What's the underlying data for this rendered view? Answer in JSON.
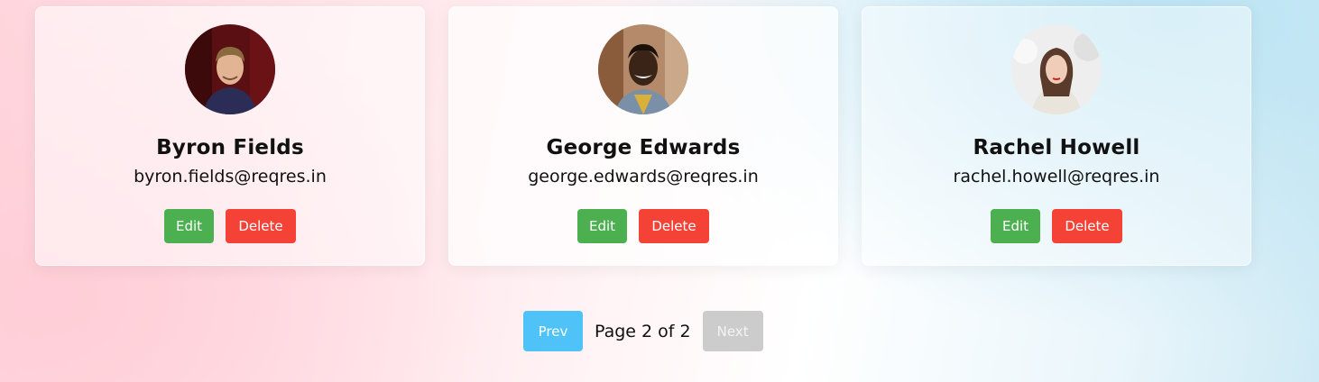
{
  "users": [
    {
      "name": "Byron Fields",
      "email": "byron.fields@reqres.in",
      "edit_label": "Edit",
      "delete_label": "Delete"
    },
    {
      "name": "George Edwards",
      "email": "george.edwards@reqres.in",
      "edit_label": "Edit",
      "delete_label": "Delete"
    },
    {
      "name": "Rachel Howell",
      "email": "rachel.howell@reqres.in",
      "edit_label": "Edit",
      "delete_label": "Delete"
    }
  ],
  "pagination": {
    "prev_label": "Prev",
    "page_text": "Page 2 of 2",
    "next_label": "Next"
  },
  "colors": {
    "edit": "#4caf50",
    "delete": "#f44336",
    "prev": "#4fc3f7",
    "next_disabled": "#cccccc"
  }
}
